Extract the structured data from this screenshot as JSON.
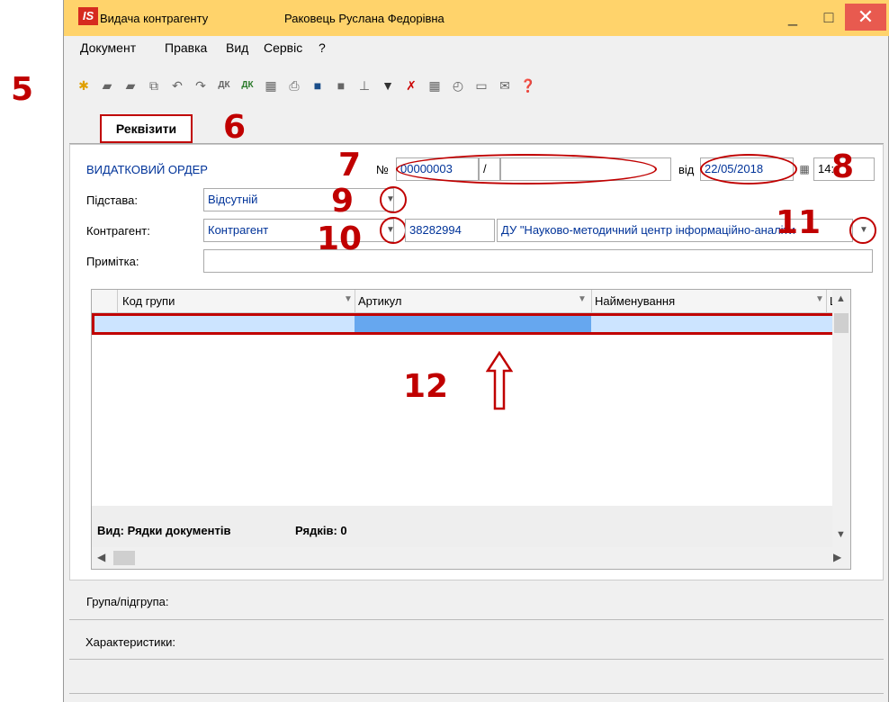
{
  "annotations": {
    "n5": "5",
    "n6": "6",
    "n7": "7",
    "n8": "8",
    "n9": "9",
    "n10": "10",
    "n11": "11",
    "n12": "12"
  },
  "window": {
    "app_icon": "IS",
    "title": "Видача контрагенту",
    "user": "Раковець Руслана Федорівна",
    "min": "_",
    "max": "□",
    "close": "✕"
  },
  "menu": [
    "Документ",
    "Правка",
    "Вид",
    "Сервіс",
    "?"
  ],
  "toolbar_icons": [
    "new-doc-icon",
    "open-icon",
    "copy-icon",
    "copy2-icon",
    "undo-icon",
    "redo-icon",
    "dk-icon",
    "dk2-icon",
    "calc-icon",
    "print-icon",
    "save-icon",
    "disk2-icon",
    "tree-icon",
    "filter-icon",
    "clear-filter-icon",
    "grid-icon",
    "clock-icon",
    "card-icon",
    "mail-icon",
    "help-icon"
  ],
  "tab": {
    "label": "Реквізити"
  },
  "form": {
    "doc_type": "ВИДАТКОВИЙ ОРДЕР",
    "num_label": "№",
    "num_value": "00000003",
    "num_sep": "/",
    "num_suffix": "",
    "date_label": "від",
    "date_value": "22/05/2018",
    "time_value": "14:",
    "basis_label": "Підстава:",
    "basis_value": "Відсутній",
    "counterparty_label": "Контрагент:",
    "counterparty_type": "Контрагент",
    "counterparty_code": "38282994",
    "counterparty_name": "ДУ \"Науково-методичний центр інформаційно-аналіти",
    "note_label": "Примітка:",
    "note_value": ""
  },
  "grid": {
    "columns": [
      "Код групи",
      "Артикул",
      "Найменування",
      "Ши"
    ],
    "footer_view": "Вид: Рядки документів",
    "footer_rows": "Рядків: 0"
  },
  "bottom": {
    "group_label": "Група/підгрупа:",
    "characteristics_label": "Характеристики:"
  },
  "colors": {
    "accent_red": "#c00000",
    "titlebar": "#ffd36b",
    "selection": "#66a7ef"
  }
}
